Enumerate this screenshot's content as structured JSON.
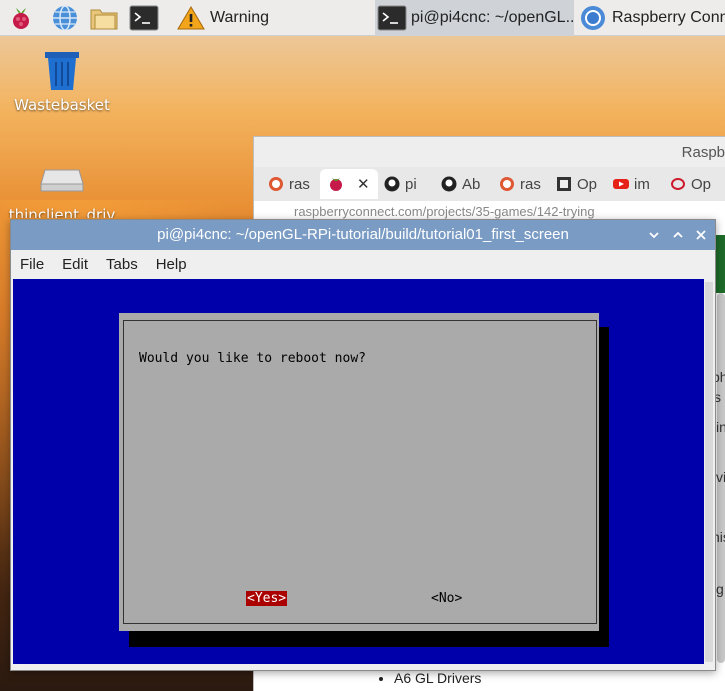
{
  "taskbar": {
    "tasks": [
      {
        "label": "Warning",
        "icon": "warning-icon"
      },
      {
        "label": "pi@pi4cnc: ~/openGL...",
        "icon": "terminal-icon",
        "active": true
      },
      {
        "label": "Raspberry Conne",
        "icon": "chromium-icon"
      }
    ],
    "launchers": [
      "raspberry-menu-icon",
      "web-browser-icon",
      "file-manager-icon",
      "terminal-icon"
    ]
  },
  "desktop": {
    "icons": [
      {
        "label": "Wastebasket",
        "icon": "trash-icon"
      },
      {
        "label": "thinclient_driv",
        "icon": "drive-icon"
      }
    ]
  },
  "browser": {
    "title": "Raspb",
    "tabs": [
      {
        "label": "ras",
        "icon": "duckduckgo-icon"
      },
      {
        "label": "",
        "icon": "raspberry-icon",
        "selected": true
      },
      {
        "label": "pi",
        "icon": "github-icon"
      },
      {
        "label": "Ab",
        "icon": "github-icon"
      },
      {
        "label": "ras",
        "icon": "duckduckgo-icon"
      },
      {
        "label": "Op",
        "icon": "app-icon"
      },
      {
        "label": "im",
        "icon": "youtube-icon"
      },
      {
        "label": "Op",
        "icon": "opera-icon"
      }
    ],
    "url": "raspberryconnect.com/projects/35-games/142-trying",
    "page_fragments": [
      "ph",
      "s",
      "in",
      "vi",
      "nis",
      "g"
    ],
    "list_item": "A6 GL Drivers"
  },
  "terminal": {
    "title": "pi@pi4cnc: ~/openGL-RPi-tutorial/build/tutorial01_first_screen",
    "menu": [
      "File",
      "Edit",
      "Tabs",
      "Help"
    ],
    "dialog": {
      "message": "Would you like to reboot now?",
      "yes_label": "<Yes>",
      "no_label": "<No>"
    },
    "colors": {
      "background": "#0000aa",
      "dialog": "#aaaaaa",
      "focus": "#aa0000"
    }
  }
}
